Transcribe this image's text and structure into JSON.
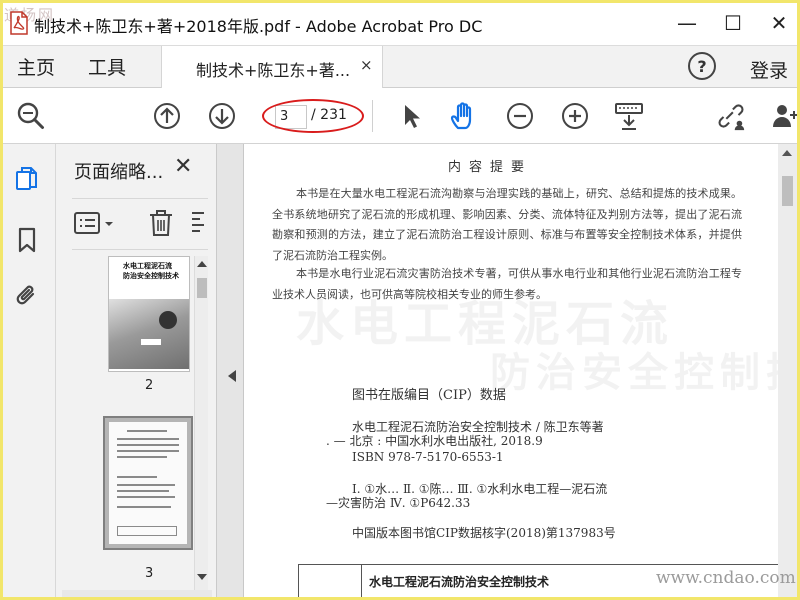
{
  "window": {
    "title": "制技术+陈卫东+著+2018年版.pdf - Adobe Acrobat Pro DC",
    "watermark": "道扬网",
    "min_glyph": "—",
    "max_glyph": "☐",
    "close_glyph": "✕"
  },
  "tabs": {
    "home": "主页",
    "tools": "工具",
    "document_tab": "制技术+陈卫东+著...",
    "document_tab_close": "×",
    "help": "?",
    "signin": "登录"
  },
  "toolbar": {
    "current_page": "3",
    "page_total": "/ 231"
  },
  "thumbnails_panel": {
    "title": "页面缩略...",
    "close": "✕",
    "thumb1_title": "水电工程泥石流\n防治安全控制技术",
    "thumb1_number": "2",
    "thumb2_number": "3"
  },
  "page": {
    "heading": "内容提要",
    "para1": "本书是在大量水电工程泥石流沟勘察与治理实践的基础上，研究、总结和提炼的技术成果。全书系统地研究了泥石流的形成机理、影响因素、分类、流体特征及判别方法等，提出了泥石流勘察和预测的方法，建立了泥石流防治工程设计原则、标准与布置等安全控制技术体系，并提供了泥石流防治工程实例。",
    "para2": "本书是水电行业泥石流灾害防治技术专著，可供从事水电行业和其他行业泥石流防治工程专业技术人员阅读，也可供高等院校相关专业的师生参考。",
    "ghost1": "水电工程泥石流",
    "ghost2": "防治安全控制技术",
    "cip_title": "图书在版编目（CIP）数据",
    "cip_line1": "水电工程泥石流防治安全控制技术 / 陈卫东等著",
    "cip_line2": ". — 北京 : 中国水利水电出版社, 2018.9",
    "cip_line3": "ISBN 978-7-5170-6553-1",
    "cip_line4": "Ⅰ. ①水… Ⅱ. ①陈… Ⅲ. ①水利水电工程—泥石流",
    "cip_line5": "—灾害防治 Ⅳ. ①P642.33",
    "cip_line6": "中国版本图书馆CIP数据核字(2018)第137983号",
    "box_title": "水电工程泥石流防治安全控制技术"
  },
  "site_watermark": "www.cndao.com",
  "colors": {
    "accent": "#1473e6",
    "annotation_oval": "#d91c1c",
    "frame": "#f2e66b"
  }
}
